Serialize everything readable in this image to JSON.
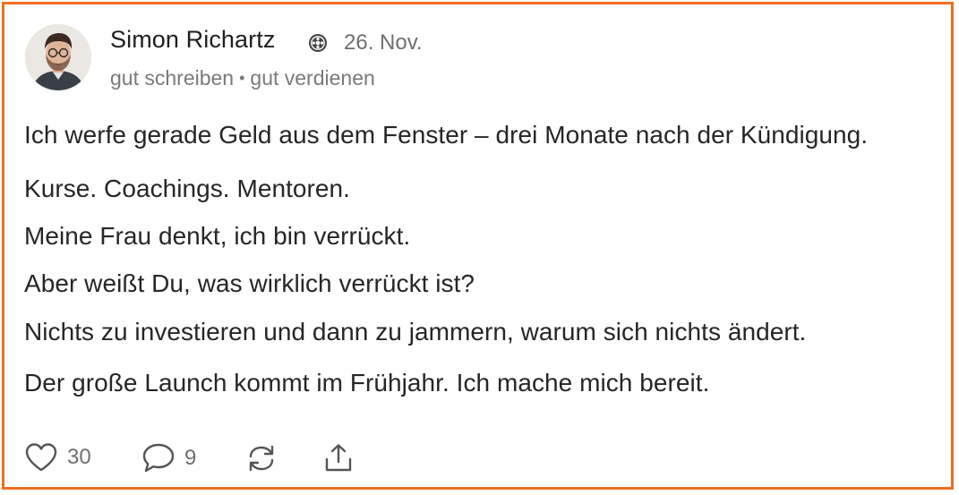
{
  "post": {
    "author": "Simon Richartz",
    "date": "26. Nov.",
    "subtitle_left": "gut schreiben",
    "subtitle_sep": "•",
    "subtitle_right": "gut verdienen",
    "paragraphs": [
      "Ich werfe gerade Geld aus dem Fenster – drei Monate nach der Kündigung.",
      "Kurse. Coachings. Mentoren.",
      "Meine Frau denkt, ich bin verrückt.",
      "Aber weißt Du, was wirklich verrückt ist?",
      "Nichts zu investieren und dann zu jammern, warum sich nichts ändert.",
      "Der große Launch kommt im Frühjahr. Ich mache mich bereit."
    ]
  },
  "actions": {
    "likes": "30",
    "comments": "9"
  },
  "icons": {
    "badge": "verified-badge-icon",
    "like": "heart-icon",
    "comment": "comment-icon",
    "restack": "restack-icon",
    "share": "share-icon"
  },
  "colors": {
    "border": "#f26e21",
    "text": "#262626",
    "muted": "#6f6f6f"
  }
}
